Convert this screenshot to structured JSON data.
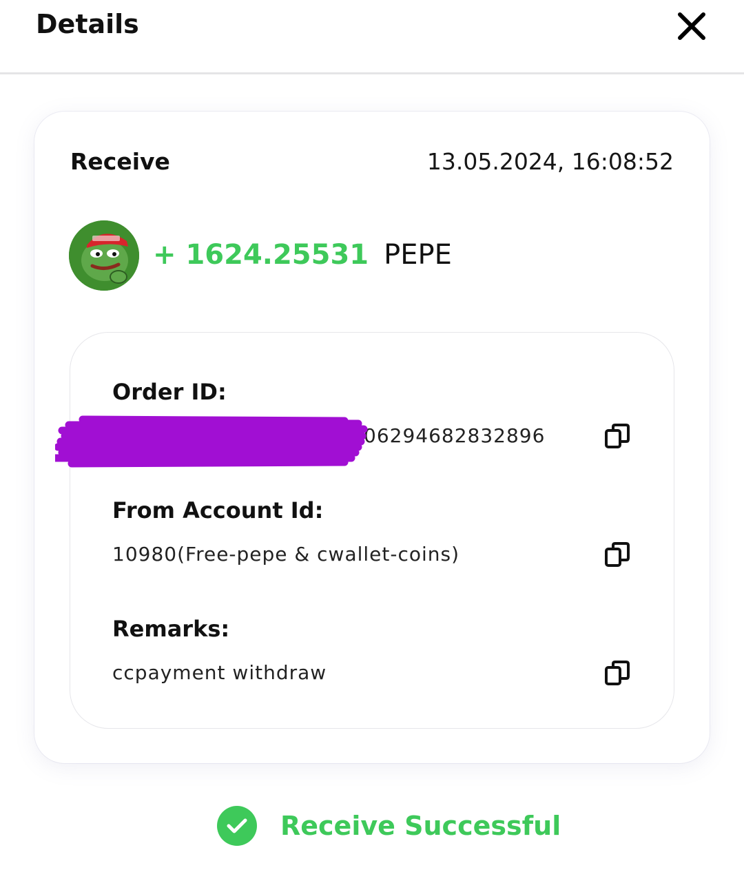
{
  "header": {
    "title": "Details",
    "close_icon": "close-icon"
  },
  "transaction": {
    "type": "Receive",
    "timestamp": "13.05.2024, 16:08:52",
    "coin_icon": "pepe-coin-avatar",
    "amount": "+ 1624.25531",
    "symbol": "PEPE"
  },
  "details": {
    "order_id_label": "Order ID:",
    "order_id_value": "06294682832896",
    "from_account_label": "From Account Id:",
    "from_account_value": "10980(Free-pepe & cwallet-coins)",
    "remarks_label": "Remarks:",
    "remarks_value": "ccpayment withdraw",
    "copy_icon": "copy-icon"
  },
  "status": {
    "text": "Receive Successful",
    "icon": "check-circle-icon"
  },
  "colors": {
    "accent_green": "#3ec95a",
    "redaction_purple": "#a10fd3"
  }
}
